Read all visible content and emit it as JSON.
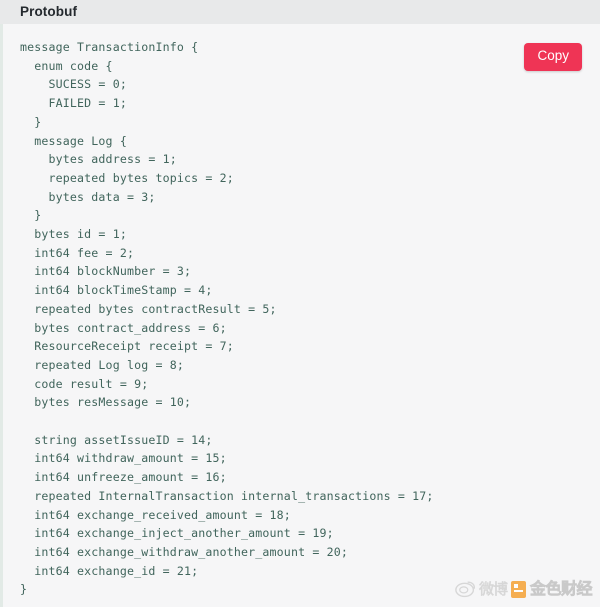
{
  "header": {
    "title": "Protobuf"
  },
  "actions": {
    "copy_label": "Copy"
  },
  "code": {
    "language": "protobuf",
    "text": "message TransactionInfo {\n  enum code {\n    SUCESS = 0;\n    FAILED = 1;\n  }\n  message Log {\n    bytes address = 1;\n    repeated bytes topics = 2;\n    bytes data = 3;\n  }\n  bytes id = 1;\n  int64 fee = 2;\n  int64 blockNumber = 3;\n  int64 blockTimeStamp = 4;\n  repeated bytes contractResult = 5;\n  bytes contract_address = 6;\n  ResourceReceipt receipt = 7;\n  repeated Log log = 8;\n  code result = 9;\n  bytes resMessage = 10;\n\n  string assetIssueID = 14;\n  int64 withdraw_amount = 15;\n  int64 unfreeze_amount = 16;\n  repeated InternalTransaction internal_transactions = 17;\n  int64 exchange_received_amount = 18;\n  int64 exchange_inject_another_amount = 19;\n  int64 exchange_withdraw_another_amount = 20;\n  int64 exchange_id = 21;\n}",
    "lines": [
      "message TransactionInfo {",
      "  enum code {",
      "    SUCESS = 0;",
      "    FAILED = 1;",
      "  }",
      "  message Log {",
      "    bytes address = 1;",
      "    repeated bytes topics = 2;",
      "    bytes data = 3;",
      "  }",
      "  bytes id = 1;",
      "  int64 fee = 2;",
      "  int64 blockNumber = 3;",
      "  int64 blockTimeStamp = 4;",
      "  repeated bytes contractResult = 5;",
      "  bytes contract_address = 6;",
      "  ResourceReceipt receipt = 7;",
      "  repeated Log log = 8;",
      "  code result = 9;",
      "  bytes resMessage = 10;",
      "",
      "  string assetIssueID = 14;",
      "  int64 withdraw_amount = 15;",
      "  int64 unfreeze_amount = 16;",
      "  repeated InternalTransaction internal_transactions = 17;",
      "  int64 exchange_received_amount = 18;",
      "  int64 exchange_inject_another_amount = 19;",
      "  int64 exchange_withdraw_another_amount = 20;",
      "  int64 exchange_id = 21;",
      "}"
    ]
  },
  "watermark": {
    "weibo_icon": "weibo-eye-icon",
    "weibo_text": "微博",
    "brand_text": "金色财经"
  },
  "colors": {
    "header_background": "#e8e9ea",
    "header_text": "#24292e",
    "code_background": "#f6f6f7",
    "code_text": "#41655c",
    "code_left_border": "#e2eae6",
    "copy_button": "#ef3455",
    "copy_button_text": "#ffffff",
    "watermark_orange": "#f59a23",
    "watermark_gray": "#d3d3d3"
  }
}
